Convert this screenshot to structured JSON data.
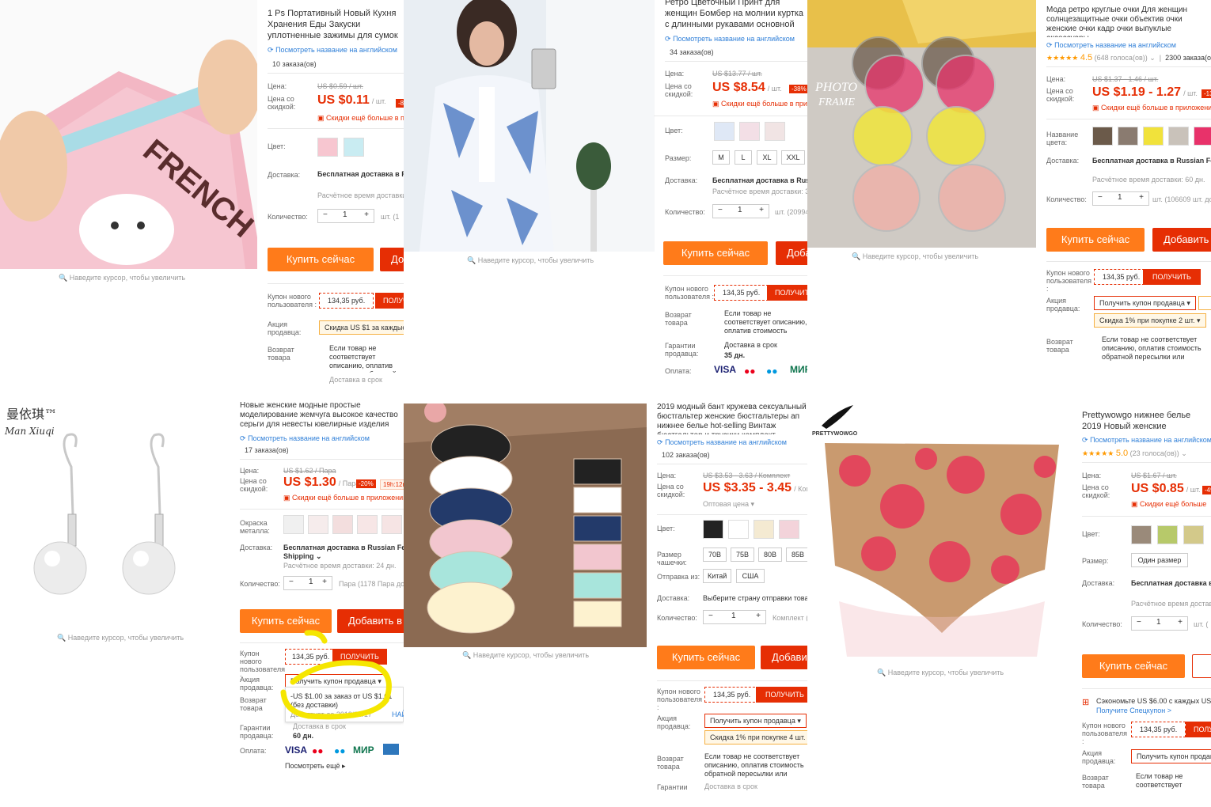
{
  "hint": "Наведите курсор, чтобы увеличить",
  "common": {
    "price_label": "Цена:",
    "discount_label": "Цена со скидкой:",
    "color_label": "Цвет:",
    "delivery_label": "Доставка:",
    "qty_label": "Количество:",
    "size_label": "Размер:",
    "buy": "Купить сейчас",
    "new_user_coupon": "Купон нового пользователя :",
    "seller_promo": "Акция продавца:",
    "refund": "Возврат товара",
    "guarantee": "Гарантии продавца:",
    "payment": "Оплата:",
    "coupon_value": "134,35 руб.",
    "get": "ПОЛУЧИТЬ",
    "eng": "Посмотреть название на английском",
    "app_discount": "Скидки ещё больше в приложении",
    "free_ship": "Бесплатная доставка в Russian Federation",
    "est_time": "Расчётное время доставки:",
    "refund_text": "Если товар не соответствует описанию, оплатив стоимость обратной пересылки или договориться о компенсации с продавцом",
    "minus": "−",
    "plus": "+",
    "qty_value": "1"
  },
  "p1": {
    "title": "1 Ps Портативный Новый Кухня Хранения Еды Закуски уплотненные зажимы для сумок пакетов для хранения Клип зажимы для пакетов",
    "orders": "10 заказа(ов)",
    "old_price": "US $0.59 / шт.",
    "price": "US $0.11",
    "unit": "/ шт.",
    "discount": "-81%",
    "delivery": "Бесплатная доставка в Russian Federation",
    "est": "Расчётное время доставки",
    "qty_note": "шт. (1",
    "add": "Добавить",
    "promo": "Скидка US $1 за каждые",
    "refund": "Если товар не соответствует описанию, оплатив стоимость обратной пересылки или договориться о компенсации",
    "delivery_term": "Доставка в срок"
  },
  "p2": {
    "title": "Ретро Цветочный Принт для женщин Бомбер на молнии куртка с длинными рукавами основной куртка",
    "orders": "34 заказа(ов)",
    "old_price": "US $13.77 / шт.",
    "price": "US $8.54",
    "unit": "/ шт.",
    "discount": "-38%",
    "app": "Скидки ещё больше в приложении",
    "sizes": [
      "M",
      "L",
      "XL",
      "XXL"
    ],
    "delivery": "Бесплатная доставка в Russian Federation",
    "est": "Расчётное время доставки: 3",
    "qty_note": "шт. (20994",
    "add": "Добавить",
    "refund": "Если товар не соответствует описанию, оплатив стоимость обратной пересылки или договориться о компенсации",
    "delivery_term": "Доставка в срок",
    "days": "35 дн.",
    "pay_logos": [
      "VISA",
      "MC",
      "MC",
      "МИР"
    ]
  },
  "p3": {
    "title": "Мода ретро круглые очки Для женщин солнцезащитные очки объектив очки женские очки кадр очки выпуклые аксессуары",
    "rating": "4.5",
    "votes": "(648 голоса(ов))",
    "orders": "2300 заказа(ов)",
    "old_price": "US $1.37 - 1.46 / шт.",
    "price": "US $1.19 - 1.27",
    "unit": "/ шт.",
    "discount": "-13%",
    "app": "Скидки ещё больше в приложении",
    "color_name": "Название цвета:",
    "delivery": "Бесплатная доставка в Russian Federation",
    "est": "Расчётное время доставки: 60 дн.",
    "qty_note": "шт. (106609 шт. дос",
    "add": "Добавить в корзину",
    "seller_coupon": "Получить купон продавца",
    "promo": "Скидка 1% при покупке 2 шт.",
    "refund": "Если товар не соответствует описанию, оплатив стоимость обратной пересылки или договориться о компенсации с продавцом"
  },
  "p4": {
    "brand": "曼依琪™",
    "brand_script": "Man Xiuqi",
    "title": "Новые женские модные простые моделирование жемчуга высокое качество серьги для невесты ювелирные изделия для девочек оптовая продажа",
    "orders": "17 заказа(ов)",
    "old_price": "US $1.62 / Пара",
    "price": "US $1.30",
    "unit": "/ Пара",
    "discount": "-20%",
    "timer": "19h:12m",
    "app": "Скидки ещё больше в приложении",
    "metal_label": "Окраска металла:",
    "delivery": "Бесплатная доставка в Russian Federation via",
    "shipping": "Shipping",
    "est": "Расчётное время доставки: 24 дн.",
    "qty_note": "Пара (1178 Пара доступ",
    "add": "Добавить в корзину",
    "seller_coupon": "Получить купон продавца",
    "popup_line1": "-US $1.00 за заказ от US $1.01",
    "popup_line2": "(без доставки)",
    "popup_line3": "Действует до 2019/05/17",
    "popup_link": "НАЙ",
    "delivery_term": "Доставка в срок",
    "days": "60 дн.",
    "more": "Посмотреть ещё",
    "pay_logos": [
      "VISA",
      "MC",
      "MC",
      "МИР",
      "AMEX"
    ]
  },
  "p5": {
    "title": "2019 модный бант кружева сексуальный бюстгальтер женские бюстгальтеры ап нижнее белье hot-selling Винтаж бюстгальтер и трусики комплект",
    "orders": "102 заказа(ов)",
    "old_price": "US $3.53 - 3.63 / Комплект",
    "price": "US $3.35 - 3.45",
    "unit": "/ Комплект",
    "wholesale": "Оптовая цена",
    "cup_label": "Размер чашечки:",
    "cups": [
      "70B",
      "75B",
      "80B",
      "85B"
    ],
    "ship_from_label": "Отправка из:",
    "ship_from": [
      "Китай",
      "США"
    ],
    "delivery": "Выберите страну отправки товара",
    "qty_note": "Комплект (10",
    "add": "Добавить",
    "seller_coupon": "Получить купон продавца",
    "promo": "Скидка 1% при покупке 4 шт.",
    "refund": "Если товар не соответствует описанию, оплатив стоимость обратной пересылки или договориться о компенсации",
    "guarantee_short": "Гарантии",
    "delivery_term": "Доставка в срок"
  },
  "p6": {
    "brand": "PRETTYWOWGO",
    "title": "Prettywowgo нижнее белье 2019 Новый женские цветочные печатные бесшовные",
    "rating": "5.0",
    "votes": "(23 голоса(ов))",
    "old_price": "US $1.67 / шт.",
    "price": "US $0.85",
    "unit": "/ шт.",
    "discount": "-49%",
    "app": "Скидки ещё больше",
    "size_value": "Один размер",
    "delivery": "Бесплатная доставка в Russian Federation",
    "est": "Расчётное время доставки",
    "qty_note": "шт. (",
    "save": "Сэкономьте US $6.00 с каждых US $",
    "save_link": "Получите Спецкупон >",
    "get": "ПОЛУ",
    "seller_coupon": "Получить купон продавца",
    "refund": "Если товар не соответствует описанию, оплатив стоимость обратной"
  },
  "colors": {
    "accent": "#e62e04",
    "buy": "#ff7b1a",
    "link": "#2f7fd8",
    "highlight": "#f5e600"
  }
}
